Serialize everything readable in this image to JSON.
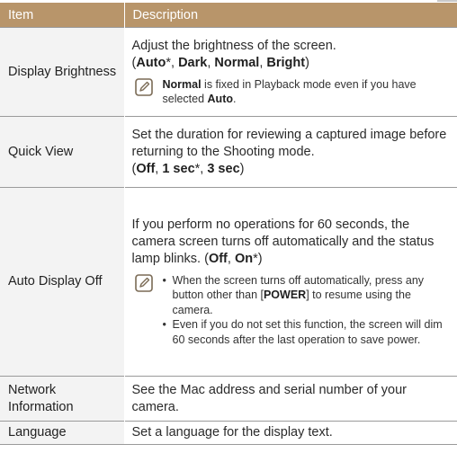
{
  "table": {
    "header": {
      "item": "Item",
      "description": "Description"
    },
    "rows": [
      {
        "item": "Display Brightness",
        "desc": "Adjust the brightness of the screen.",
        "opts": {
          "open": "(",
          "o1": "Auto",
          "s1": "*, ",
          "o2": "Dark",
          "s2": ", ",
          "o3": "Normal",
          "s3": ", ",
          "o4": "Bright",
          "close": ")"
        },
        "note": {
          "b1": "Normal",
          "t1": " is fixed in Playback mode even if you have selected ",
          "b2": "Auto",
          "t2": "."
        }
      },
      {
        "item": "Quick View",
        "desc": "Set the duration for reviewing a captured image before returning to the Shooting mode.",
        "opts": {
          "open": "(",
          "o1": "Off",
          "s1": ", ",
          "o2": "1 sec",
          "s2": "*, ",
          "o3": "3 sec",
          "close": ")"
        }
      },
      {
        "item": "Auto Display Off",
        "desc": "If you perform no operations for 60 seconds, the camera screen turns off automatically and the status lamp blinks. ",
        "opts": {
          "open": "(",
          "o1": "Off",
          "s1": ", ",
          "o2": "On",
          "close": "*)"
        },
        "note": {
          "bullet1": {
            "t1": "When the screen turns off automatically, press any button other than [",
            "b1": "POWER",
            "t2": "] to resume using the camera."
          },
          "bullet2": "Even if you do not set this function, the screen will dim 60 seconds after the last operation to save power."
        }
      },
      {
        "item": "Network Information",
        "desc": "See the Mac address and serial number of your camera."
      },
      {
        "item": "Language",
        "desc": "Set a language for the display text."
      }
    ]
  },
  "icons": {
    "note": "note-pencil-icon"
  },
  "colors": {
    "header_bg": "#b8956a",
    "item_bg": "#f3f3f3",
    "rule": "#9a9a9a"
  }
}
